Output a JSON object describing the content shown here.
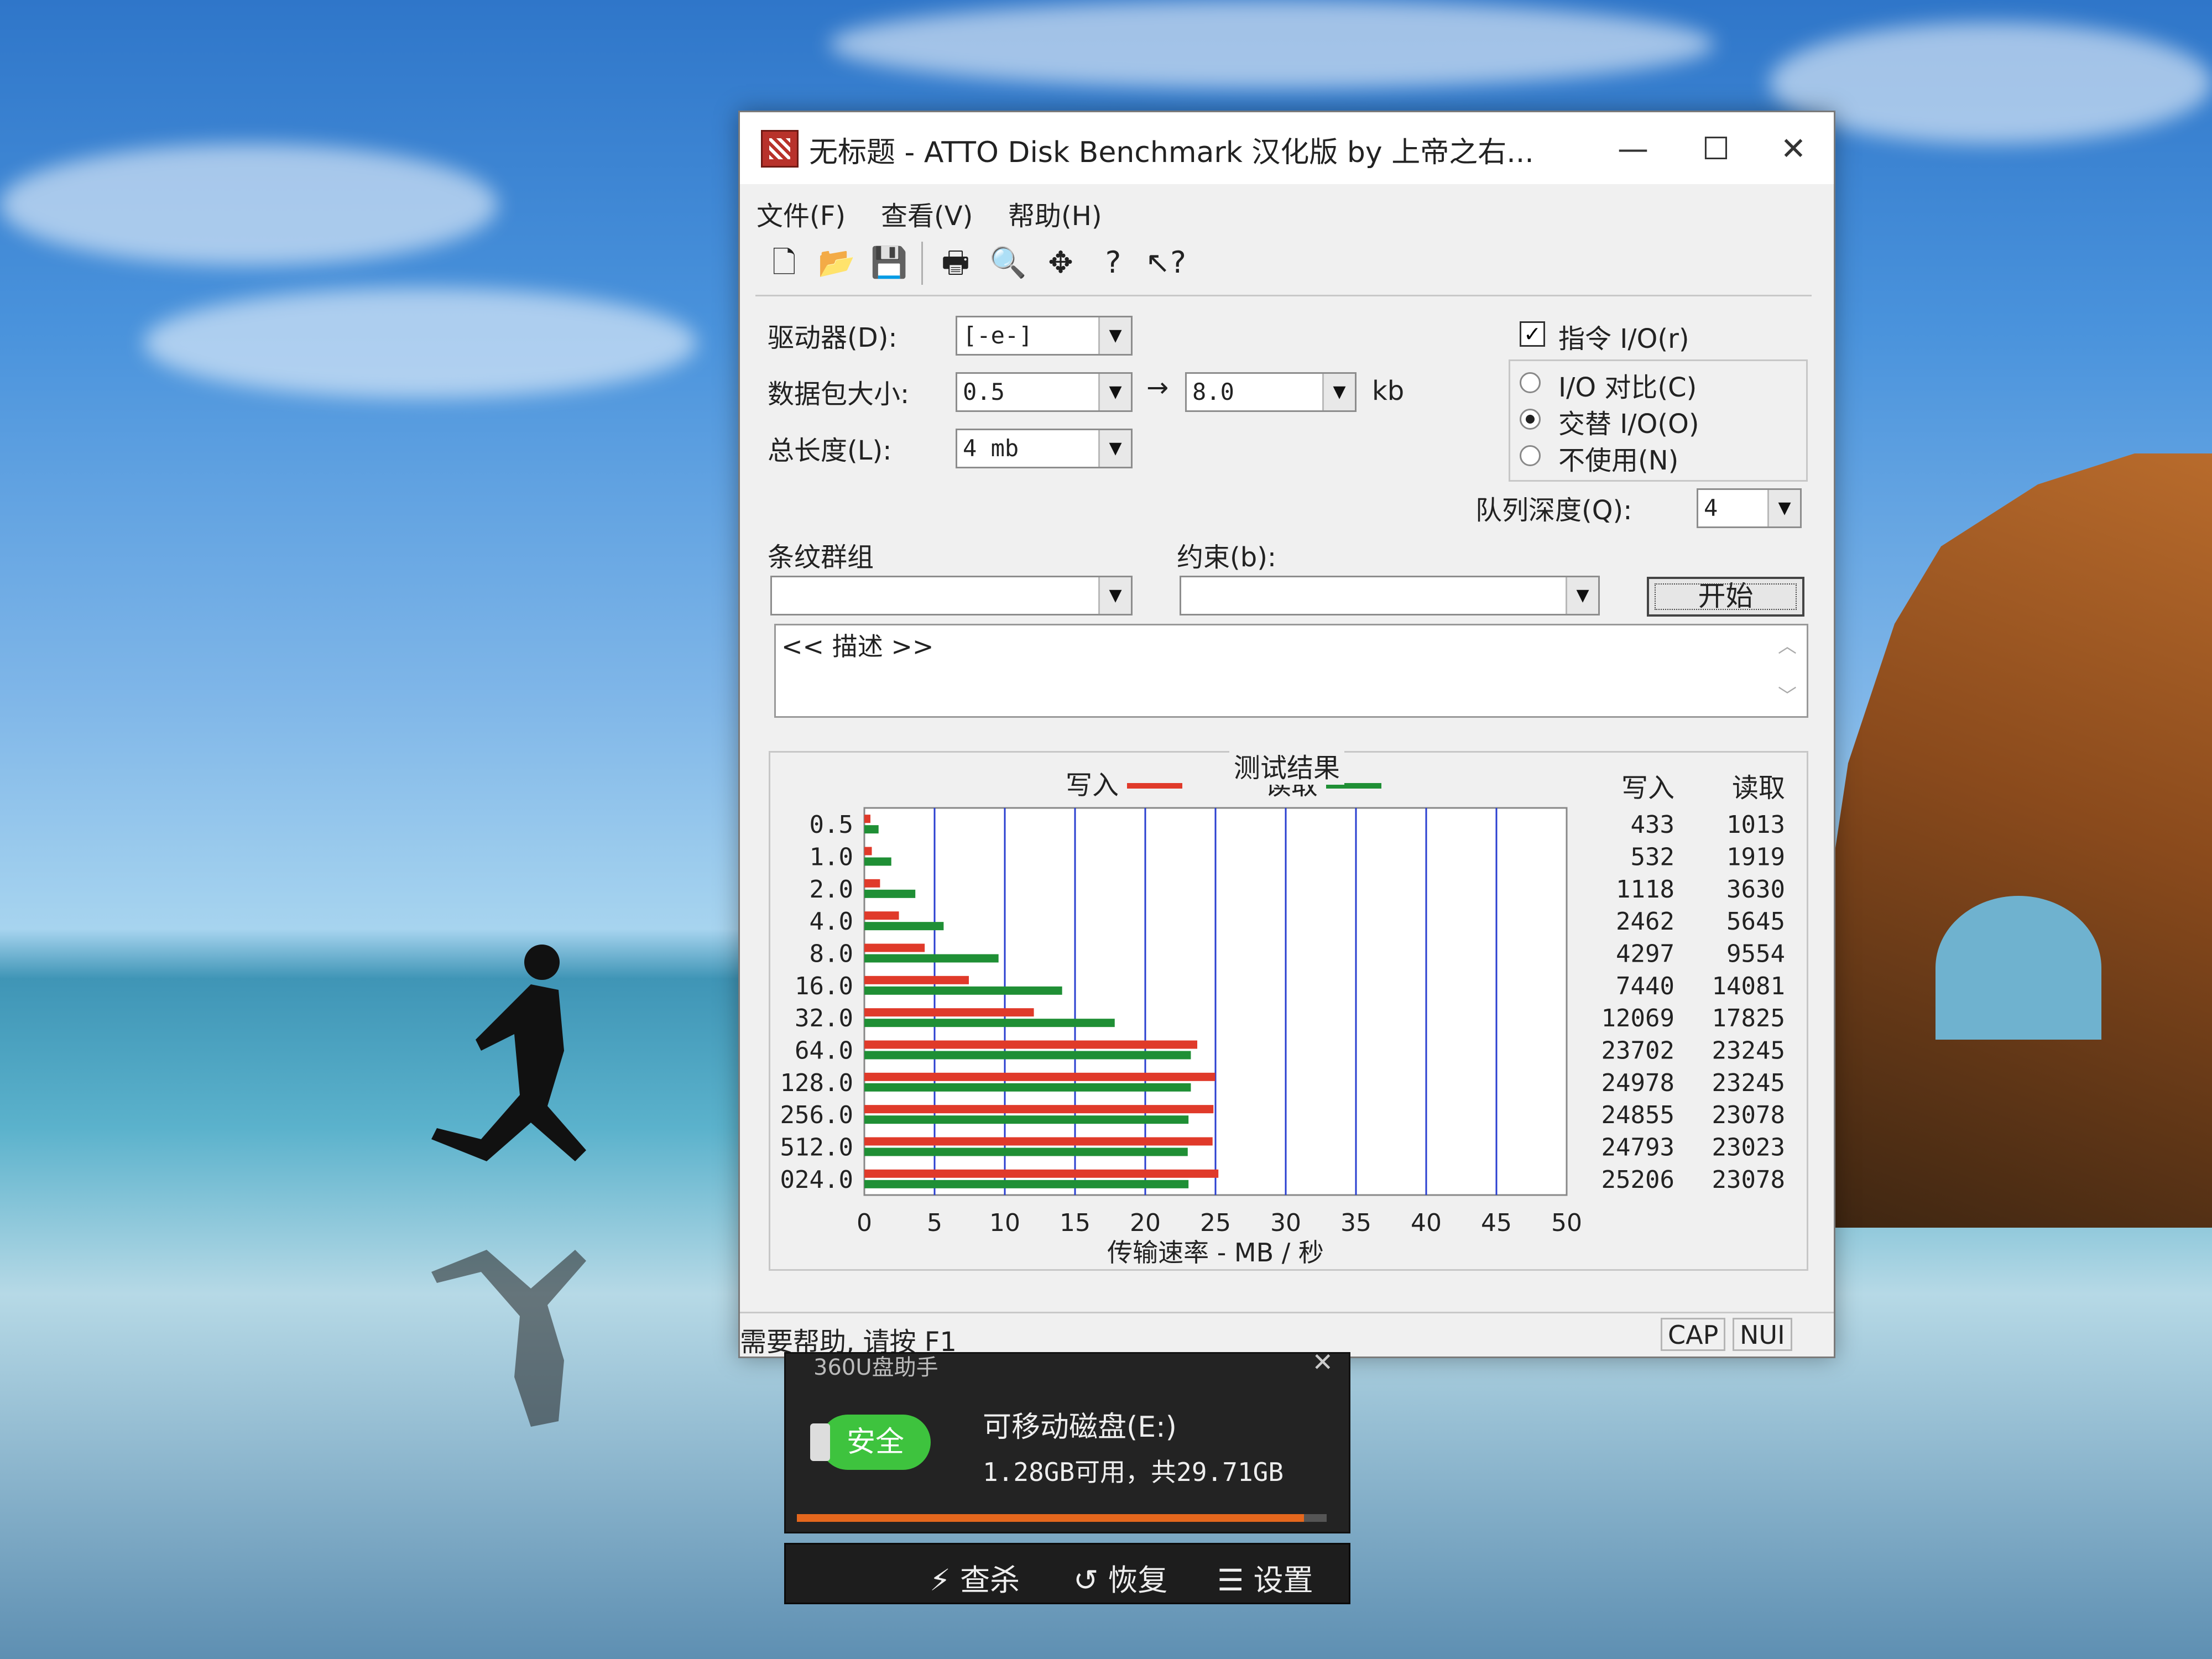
{
  "window": {
    "title": "无标题 - ATTO Disk Benchmark  汉化版 by 上帝之右...",
    "controls": {
      "minimize": "—",
      "maximize": "☐",
      "close": "✕"
    }
  },
  "menu": [
    "文件(F)",
    "查看(V)",
    "帮助(H)"
  ],
  "toolbar_icons": [
    "new-file-icon",
    "open-folder-icon",
    "save-icon",
    "print-icon",
    "print-preview-icon",
    "move-icon",
    "help-icon",
    "context-help-icon"
  ],
  "form": {
    "drive_label": "驱动器(D):",
    "drive_value": "[-e-]",
    "packet_label": "数据包大小:",
    "packet_from": "0.5",
    "arrow": "→",
    "packet_to": "8.0",
    "unit": "kb",
    "total_label": "总长度(L):",
    "total_value": "4 mb",
    "stripe_label": "条纹群组",
    "stripe_value": "",
    "constraint_label": "约束(b):",
    "constraint_value": "",
    "queue_label": "队列深度(Q):",
    "queue_value": "4",
    "start_button": "开始",
    "description": "<< 描述 >>"
  },
  "io_options": {
    "direct_io": {
      "label": "指令 I/O(r)",
      "checked": true
    },
    "radios": [
      {
        "label": "I/O 对比(C)",
        "selected": false
      },
      {
        "label": "交替 I/O(O)",
        "selected": true
      },
      {
        "label": "不使用(N)",
        "selected": false
      }
    ]
  },
  "results": {
    "title": "测试结果",
    "write_header": "写入",
    "read_header": "读取"
  },
  "chart_data": {
    "type": "bar",
    "orientation": "horizontal",
    "title": "测试结果",
    "xlabel": "传输速率 - MB / 秒",
    "ylabel": "",
    "xlim": [
      0,
      50
    ],
    "x_ticks": [
      "0",
      "5",
      "10",
      "15",
      "20",
      "25",
      "30",
      "35",
      "40",
      "45",
      "50"
    ],
    "categories": [
      "0.5",
      "1.0",
      "2.0",
      "4.0",
      "8.0",
      "16.0",
      "32.0",
      "64.0",
      "128.0",
      "256.0",
      "512.0",
      "024.0"
    ],
    "series": [
      {
        "name": "写入",
        "color": "#e03a2a",
        "values": [
          433,
          532,
          1118,
          2462,
          4297,
          7440,
          12069,
          23702,
          24978,
          24855,
          24793,
          25206
        ]
      },
      {
        "name": "读取",
        "color": "#1f8f35",
        "values": [
          1013,
          1919,
          3630,
          5645,
          9554,
          14081,
          17825,
          23245,
          23245,
          23078,
          23023,
          23078
        ]
      }
    ],
    "value_unit_divisor": 1000,
    "grid": true,
    "legend": "top"
  },
  "statusbar": {
    "help": "需要帮助, 请按 F1",
    "cap": "CAP",
    "num": "NUI"
  },
  "popup": {
    "title": "360U盘助手",
    "close": "✕",
    "badge": "安全",
    "disk_name": "可移动磁盘(E:)",
    "disk_space": "1.28GB可用，共29.71GB",
    "used_fraction": 0.957,
    "actions": [
      {
        "icon": "lightning-icon",
        "label": "查杀"
      },
      {
        "icon": "restore-icon",
        "label": "恢复"
      },
      {
        "icon": "list-icon",
        "label": "设置"
      }
    ]
  }
}
